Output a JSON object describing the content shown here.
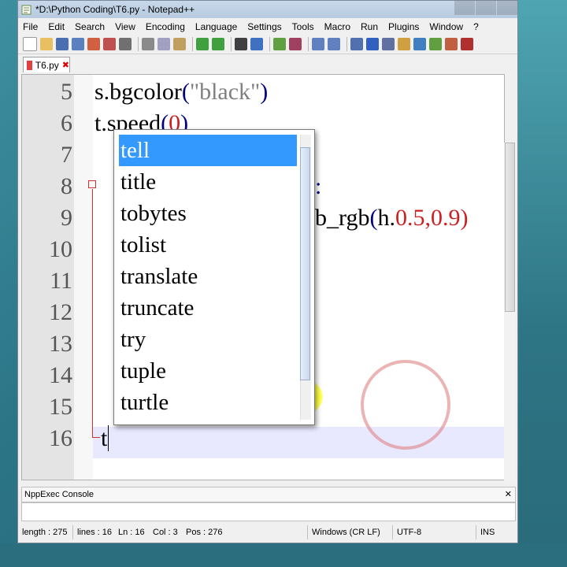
{
  "window": {
    "title": "*D:\\Python Coding\\T6.py - Notepad++"
  },
  "menu": [
    "File",
    "Edit",
    "Search",
    "View",
    "Encoding",
    "Language",
    "Settings",
    "Tools",
    "Macro",
    "Run",
    "Plugins",
    "Window",
    "?"
  ],
  "tabs": [
    {
      "label": "T6.py",
      "close": "✖"
    }
  ],
  "editor": {
    "line_numbers": [
      "5",
      "6",
      "7",
      "8",
      "9",
      "10",
      "11",
      "12",
      "13",
      "14",
      "15",
      "16"
    ],
    "lines": [
      {
        "a": "s.bgcolor",
        "b": "(",
        "c": "\"black\"",
        "d": ")"
      },
      {
        "a": "t.speed",
        "b": "(",
        "c": "0",
        "d": ")"
      },
      {
        "a": "",
        "b": "",
        "c": "",
        "d": ""
      },
      {
        "a": "",
        "b": "",
        "c": "",
        "d": "):"
      },
      {
        "a": "b_rgb",
        "b": "(",
        "c": "h.",
        "d": "0.5,0.9)"
      },
      {
        "a": "t",
        "b": "",
        "c": "",
        "d": ""
      }
    ]
  },
  "autocomplete": {
    "items": [
      "tell",
      "title",
      "tobytes",
      "tolist",
      "translate",
      "truncate",
      "try",
      "tuple",
      "turtle"
    ],
    "selected": "tell"
  },
  "console": {
    "title": "NppExec Console",
    "close": "✕"
  },
  "status": {
    "length": "length : 275",
    "lines": "lines : 16",
    "ln": "Ln : 16",
    "col": "Col : 3",
    "pos": "Pos : 276",
    "eol": "Windows (CR LF)",
    "encoding": "UTF-8",
    "mode": "INS"
  },
  "colors": {
    "selection": "#3399ff",
    "string": "#808080",
    "number": "#cc2020"
  }
}
